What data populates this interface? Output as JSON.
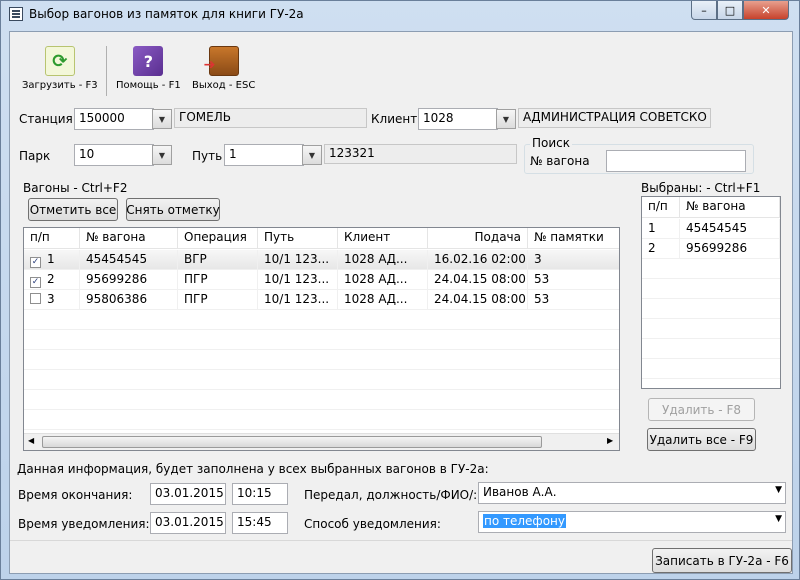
{
  "window": {
    "title": "Выбор вагонов из памяток для книги ГУ-2а",
    "minimize": "–",
    "maximize": "□",
    "close": "✕"
  },
  "toolbar": {
    "load_label": "Загрузить - F3",
    "help_label": "Помощь - F1",
    "exit_label": "Выход - ESC",
    "load_icon": "refresh-icon",
    "help_icon": "help-book-icon",
    "exit_icon": "exit-door-icon"
  },
  "station": {
    "label": "Станция",
    "code": "150000",
    "name": "ГОМЕЛЬ"
  },
  "client": {
    "label": "Клиент",
    "code": "1028",
    "name": "АДМИНИСТРАЦИЯ СОВЕТСКО"
  },
  "park": {
    "label": "Парк",
    "value": "10"
  },
  "path": {
    "label": "Путь",
    "value": "1",
    "extra": "123321"
  },
  "search": {
    "group_label": "Поиск",
    "wagon_label": "№ вагона",
    "wagon_value": ""
  },
  "wagons": {
    "group_label": "Вагоны - Ctrl+F2",
    "mark_all": "Отметить все",
    "unmark": "Снять отметку",
    "columns": [
      "п/п",
      "№ вагона",
      "Операция",
      "Путь",
      "Клиент",
      "Подача",
      "№ памятки"
    ],
    "rows": [
      {
        "checked": true,
        "num": "1",
        "wagon": "45454545",
        "op": "ВГР",
        "path": "10/1   123...",
        "client": "1028   АД...",
        "time": "16.02.16 02:00",
        "memo": "3"
      },
      {
        "checked": true,
        "num": "2",
        "wagon": "95699286",
        "op": "ПГР",
        "path": "10/1   123...",
        "client": "1028   АД...",
        "time": "24.04.15 08:00",
        "memo": "53"
      },
      {
        "checked": false,
        "num": "3",
        "wagon": "95806386",
        "op": "ПГР",
        "path": "10/1   123...",
        "client": "1028   АД...",
        "time": "24.04.15 08:00",
        "memo": "53"
      }
    ]
  },
  "selected": {
    "group_label": "Выбраны: - Ctrl+F1",
    "columns": [
      "п/п",
      "№ вагона"
    ],
    "rows": [
      {
        "num": "1",
        "wagon": "45454545"
      },
      {
        "num": "2",
        "wagon": "95699286"
      }
    ],
    "delete_label": "Удалить - F8",
    "delete_all_label": "Удалить все - F9"
  },
  "info": {
    "header": "Данная информация, будет заполнена у всех выбранных вагонов в ГУ-2а:",
    "end_label": "Время окончания:",
    "end_date": "03.01.2015",
    "end_time": "10:15",
    "notify_label": "Время уведомления:",
    "notify_date": "03.01.2015",
    "notify_time": "15:45",
    "passed_label": "Передал, должность/ФИО/:",
    "passed_value": "Иванов А.А.",
    "method_label": "Способ уведомления:",
    "method_value": "по телефону"
  },
  "submit_label": "Записать в ГУ-2а - F6"
}
